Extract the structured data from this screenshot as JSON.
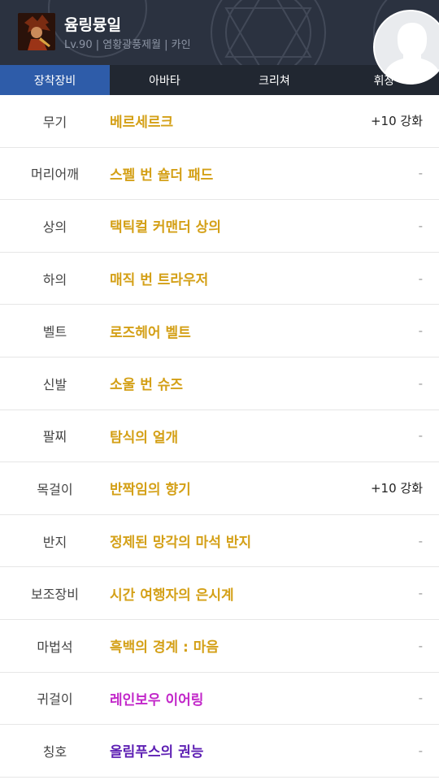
{
  "header": {
    "name": "윰링뮹일",
    "subtitle": "Lv.90 | 염황광풍제월 | 카인"
  },
  "tabs": [
    {
      "label": "장착장비",
      "active": true
    },
    {
      "label": "아바타",
      "active": false
    },
    {
      "label": "크리쳐",
      "active": false
    },
    {
      "label": "휘장",
      "active": false
    }
  ],
  "colors": {
    "unique": "#d4a017",
    "rare": "#c227c9",
    "legendary": "#5d1fb3",
    "tab_active": "#2e5ca9"
  },
  "equipment": [
    {
      "slot": "무기",
      "item": "베르세르크",
      "enhance": "+10 강화",
      "rarity": "unique"
    },
    {
      "slot": "머리어깨",
      "item": "스펠 번 숄더 패드",
      "enhance": "-",
      "rarity": "unique"
    },
    {
      "slot": "상의",
      "item": "택틱컬 커맨더 상의",
      "enhance": "-",
      "rarity": "unique"
    },
    {
      "slot": "하의",
      "item": "매직 번 트라우저",
      "enhance": "-",
      "rarity": "unique"
    },
    {
      "slot": "벨트",
      "item": "로즈헤어 벨트",
      "enhance": "-",
      "rarity": "unique"
    },
    {
      "slot": "신발",
      "item": "소울 번 슈즈",
      "enhance": "-",
      "rarity": "unique"
    },
    {
      "slot": "팔찌",
      "item": "탐식의 얼개",
      "enhance": "-",
      "rarity": "unique"
    },
    {
      "slot": "목걸이",
      "item": "반짝임의 향기",
      "enhance": "+10 강화",
      "rarity": "unique"
    },
    {
      "slot": "반지",
      "item": "정제된 망각의 마석 반지",
      "enhance": "-",
      "rarity": "unique"
    },
    {
      "slot": "보조장비",
      "item": "시간 여행자의 은시계",
      "enhance": "-",
      "rarity": "unique"
    },
    {
      "slot": "마법석",
      "item": "흑백의 경계 : 마음",
      "enhance": "-",
      "rarity": "unique"
    },
    {
      "slot": "귀걸이",
      "item": "레인보우 이어링",
      "enhance": "-",
      "rarity": "rare"
    },
    {
      "slot": "칭호",
      "item": "올림푸스의 권능",
      "enhance": "-",
      "rarity": "legendary"
    }
  ]
}
